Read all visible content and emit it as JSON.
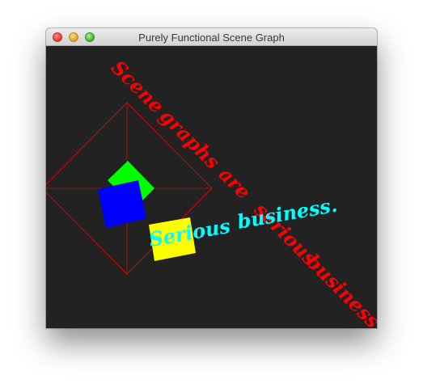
{
  "window": {
    "title": "Purely Functional Scene Graph",
    "buttons": [
      "close",
      "minimize",
      "zoom"
    ]
  },
  "scene": {
    "background_color": "#222222",
    "red_text": {
      "words": [
        "Scene",
        "graphs",
        "are",
        "serious",
        "business."
      ],
      "color": "#ff0000"
    },
    "cyan_text": {
      "words": [
        "Serious",
        "business."
      ],
      "color": "#00ffff"
    },
    "outline_color": "#ff0000",
    "square_colors": {
      "green": "#00ff00",
      "blue": "#0000ff",
      "yellow": "#ffff00"
    }
  }
}
